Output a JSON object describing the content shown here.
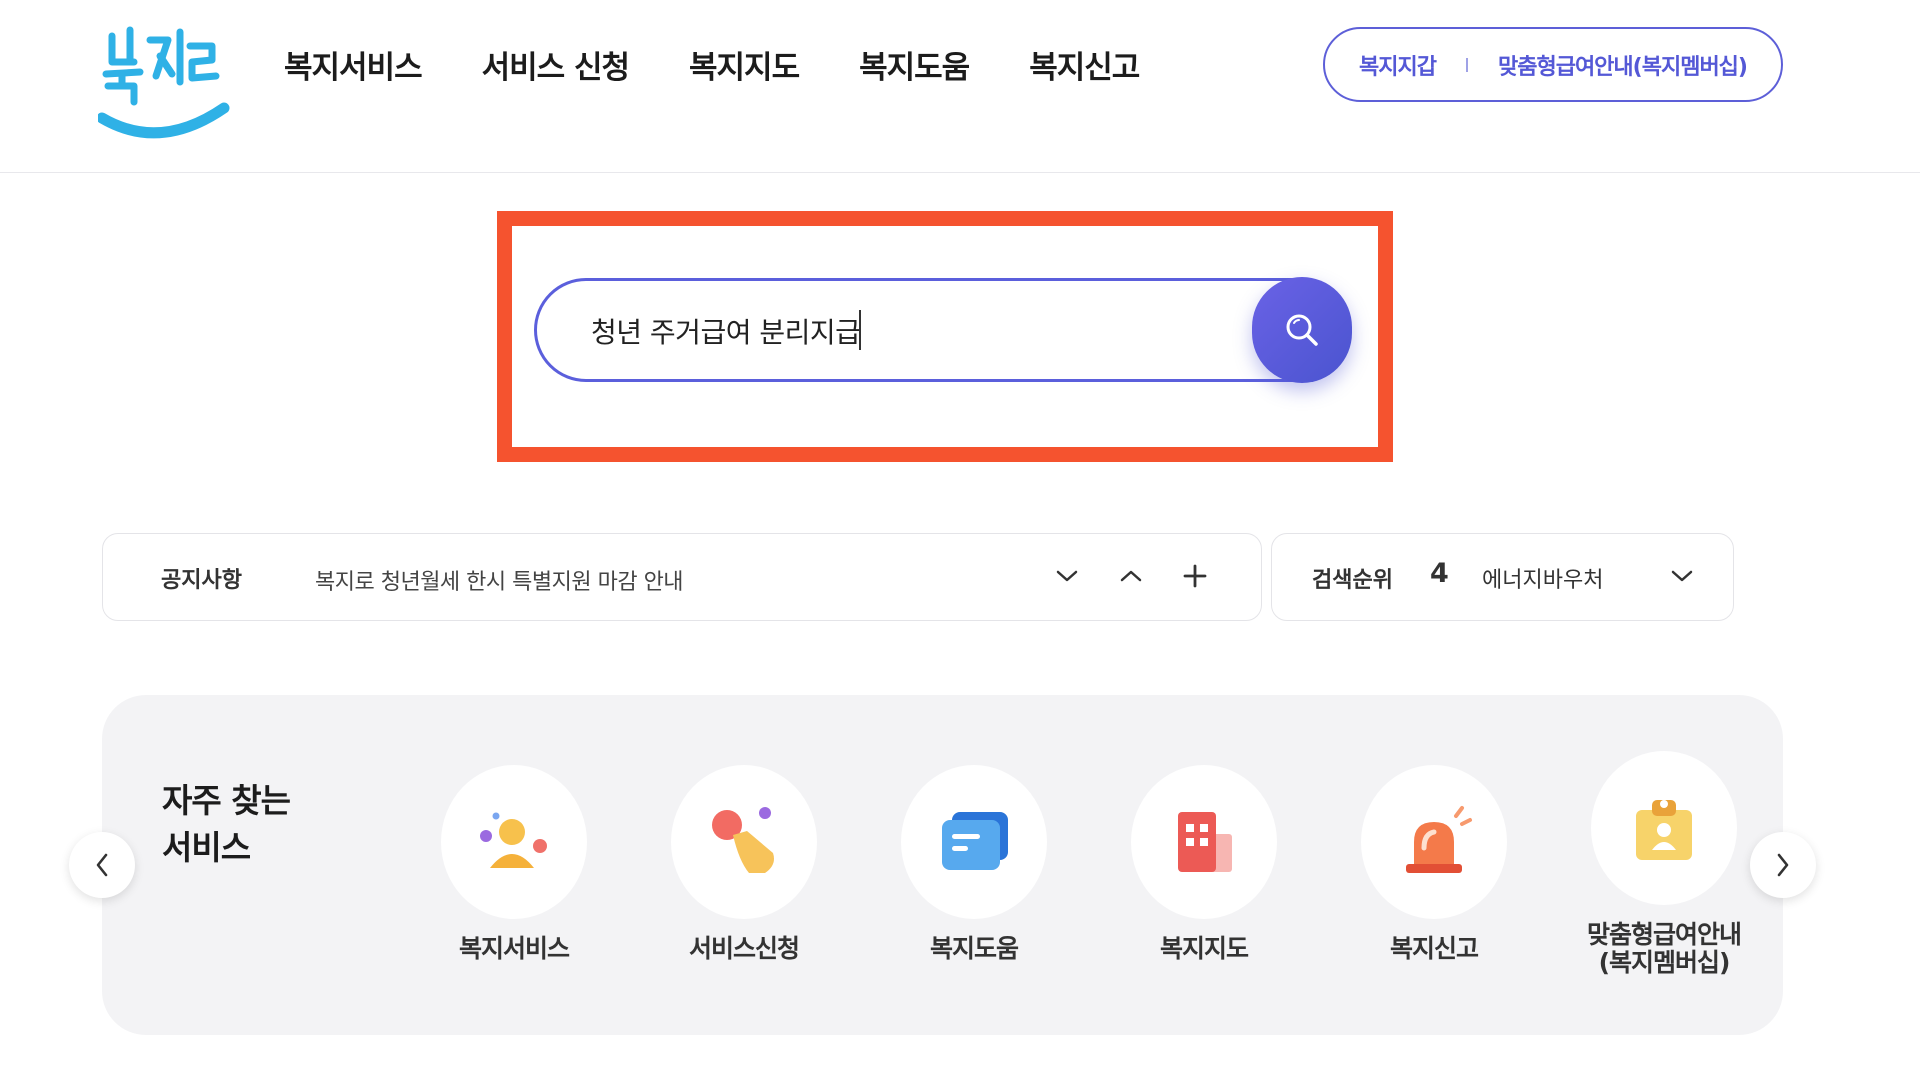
{
  "header": {
    "logo_text": "복지로",
    "nav": [
      "복지서비스",
      "서비스 신청",
      "복지지도",
      "복지도움",
      "복지신고"
    ],
    "quick_links": [
      "복지지갑",
      "맞춤형급여안내(복지멤버십)"
    ]
  },
  "search": {
    "value": "청년 주거급여 분리지급",
    "icon": "search-icon"
  },
  "notice": {
    "label": "공지사항",
    "text": "복지로 청년월세 한시 특별지원 마감 안내",
    "controls": [
      "chevron-down-icon",
      "chevron-up-icon",
      "plus-icon"
    ]
  },
  "ranking": {
    "label": "검색순위",
    "rank": "4",
    "keyword": "에너지바우처",
    "control": "chevron-down-icon"
  },
  "services": {
    "title_line1": "자주 찾는",
    "title_line2": "서비스",
    "items": [
      {
        "label": "복지서비스",
        "icon": "person-icon"
      },
      {
        "label": "서비스신청",
        "icon": "hand-tap-icon"
      },
      {
        "label": "복지도움",
        "icon": "chat-icon"
      },
      {
        "label": "복지지도",
        "icon": "building-icon"
      },
      {
        "label": "복지신고",
        "icon": "siren-icon"
      },
      {
        "label_line1": "맞춤형급여안내",
        "label_line2": "(복지멤버십)",
        "icon": "id-badge-icon"
      }
    ],
    "prev_icon": "chevron-left-icon",
    "next_icon": "chevron-right-icon"
  },
  "colors": {
    "accent": "#5b5fdc",
    "highlight": "#f5532f",
    "panel_bg": "#f3f3f5"
  }
}
